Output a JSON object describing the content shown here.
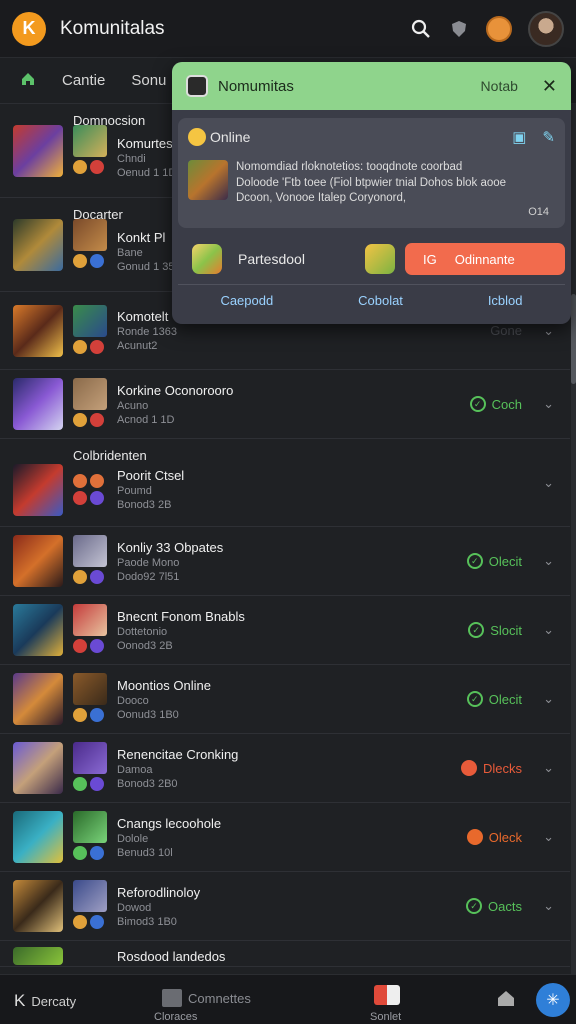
{
  "app": {
    "logo_letter": "K",
    "title": "Komunitalas"
  },
  "tabs": [
    {
      "label": "Cantie"
    },
    {
      "label": "Sonu"
    }
  ],
  "sections": {
    "first": "Domnocsion",
    "second": "Docarter",
    "third": "Colbridenten"
  },
  "rows": [
    {
      "title": "Komurtese",
      "sub1": "Chndi",
      "sub2": "Oenud 1 1D",
      "status": "",
      "status_color": ""
    },
    {
      "title": "Konkt Pl",
      "sub1": "Bane",
      "sub2": "Gonud 1 35",
      "status": "",
      "status_color": ""
    },
    {
      "title": "Komotelt",
      "sub1": "Ronde 1363",
      "sub2": "Acunut2",
      "status": "Gone",
      "status_color": "#4a4c52"
    },
    {
      "title": "Korkine Oconorooro",
      "sub1": "Acuno",
      "sub2": "Acnod 1 1D",
      "status": "Coch",
      "status_color": "#57c15a"
    },
    {
      "title": "Poorit Ctsel",
      "sub1": "Poumd",
      "sub2": "Bonod3 2B",
      "status": "",
      "status_color": ""
    },
    {
      "title": "Konliy 33 Obpates",
      "sub1": "Paode Mono",
      "sub2": "Dodo92 7l51",
      "status": "Olecit",
      "status_color": "#57c15a"
    },
    {
      "title": "Bnecnt Fonom Bnabls",
      "sub1": "Dottetonio",
      "sub2": "Oonod3 2B",
      "status": "Slocit",
      "status_color": "#57c15a"
    },
    {
      "title": "Moontios Online",
      "sub1": "Dooco",
      "sub2": "Oonud3 1B0",
      "status": "Olecit",
      "status_color": "#57c15a"
    },
    {
      "title": "Renencitae Cronking",
      "sub1": "Damoa",
      "sub2": "Bonod3 2B0",
      "status": "Dlecks",
      "status_color": "#e85b3a"
    },
    {
      "title": "Cnangs lecoohole",
      "sub1": "Dolole",
      "sub2": "Benud3 10l",
      "status": "Oleck",
      "status_color": "#e8692c"
    },
    {
      "title": "Reforodlinoloy",
      "sub1": "Dowod",
      "sub2": "Bimod3 1B0",
      "status": "Oacts",
      "status_color": "#57c15a"
    },
    {
      "title": "Rosdood landedos",
      "sub1": "",
      "sub2": "",
      "status": "",
      "status_color": ""
    }
  ],
  "popup": {
    "title": "Nomumitas",
    "notab": "Notab",
    "card": {
      "status": "Online",
      "text_line1": "Nomomdiad rloknotetios: tooqdnote coorbad",
      "text_line2": "Doloode 'Ftb toee (Fiol btpwier tnial Dohos blok aooe",
      "text_line3": "Dcoon, Vonooe Italep Coryonord,",
      "count": "O14"
    },
    "action_label": "Partesdool",
    "primary_prefix": "IG",
    "primary_label": "Odinnante",
    "links": [
      "Caepodd",
      "Cobolat",
      "Icblod"
    ]
  },
  "bottombar": {
    "left_letter": "K",
    "left_label": "Dercaty",
    "center_label": "Comnettes",
    "center_sub": "Cloraces",
    "right_sub": "Sonlet"
  },
  "colors": {
    "accent": "#f39a1e",
    "popup_head": "#8fd48c",
    "primary": "#f26b4d",
    "link": "#9ad2ff",
    "ok": "#57c15a"
  }
}
